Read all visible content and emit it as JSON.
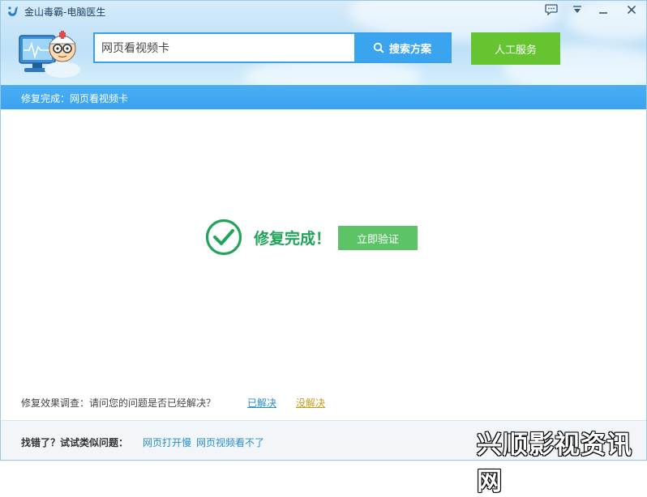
{
  "app": {
    "title": "金山毒霸-电脑医生"
  },
  "header": {
    "search_value": "网页看视频卡",
    "search_button": "搜索方案",
    "service_button": "人工服务"
  },
  "breadcrumb": "修复完成：网页看视频卡",
  "result": {
    "status": "修复完成！",
    "verify_button": "立即验证"
  },
  "survey": {
    "question": "修复效果调查：请问您的问题是否已经解决？",
    "yes": "已解决",
    "no": "没解决"
  },
  "footer": {
    "label": "找错了？试试类似问题：",
    "links": [
      "网页打开慢",
      "网页视频看不了"
    ]
  },
  "watermark": "兴顺影视资讯网",
  "colors": {
    "accent": "#3aa3f0",
    "service": "#65c42f",
    "success": "#21a45a",
    "verify": "#5cc366"
  }
}
